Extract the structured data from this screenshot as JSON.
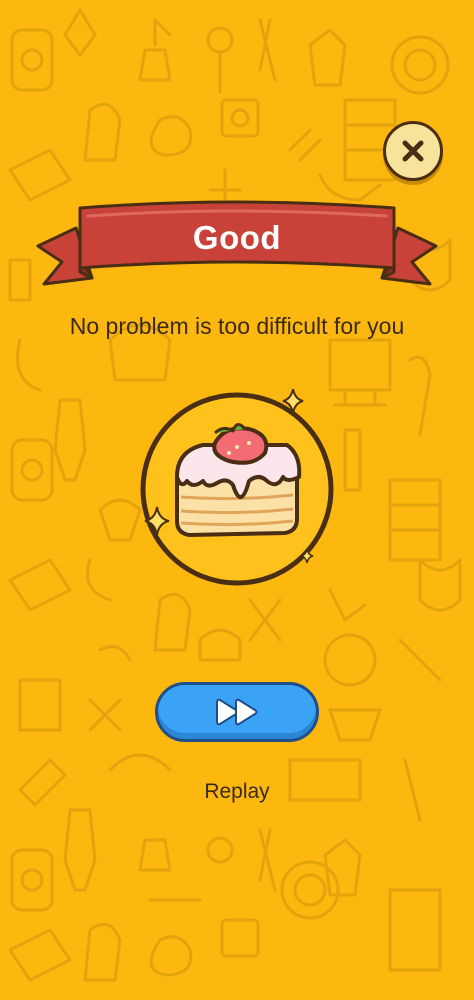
{
  "background": {
    "color": "#FDB810",
    "pattern": "doodle-icons"
  },
  "header": {
    "close_icon": "close-icon"
  },
  "banner": {
    "title": "Good",
    "ribbon_color": "#C8423A"
  },
  "message": {
    "text": "No problem is too difficult for you"
  },
  "reward": {
    "icon": "strawberry-cake-icon"
  },
  "actions": {
    "replay_icon": "fast-forward-icon",
    "replay_label": "Replay",
    "button_color": "#3BA3F5"
  }
}
